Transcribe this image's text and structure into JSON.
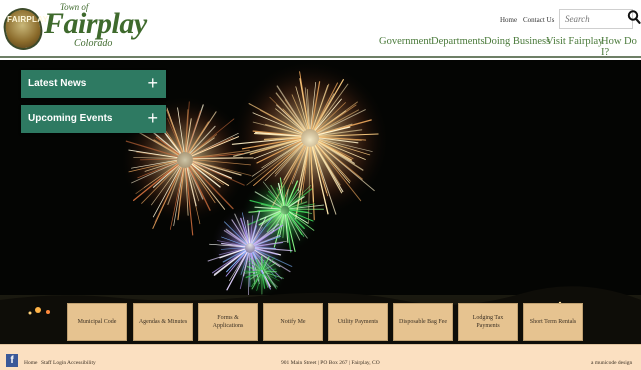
{
  "logo": {
    "town_of": "Town of",
    "name": "Fairplay",
    "state": "Colorado",
    "badge": "FAIRPLAY"
  },
  "utility_nav": {
    "home": "Home",
    "contact": "Contact Us"
  },
  "search": {
    "placeholder": "Search"
  },
  "main_nav": [
    "Government",
    "Departments",
    "Doing Business",
    "Visit Fairplay",
    "How Do I?"
  ],
  "accordion": [
    "Latest News",
    "Upcoming Events"
  ],
  "quick_links": [
    "Municipal Code",
    "Agendas & Minutes",
    "Forms & Applications",
    "Notify Me",
    "Utility Payments",
    "Disposable Bag Fee",
    "Lodging Tax Payments",
    "Short Term Rentals"
  ],
  "footer": {
    "links": [
      "Home",
      "Staff Login",
      "Accessibility"
    ],
    "address": "901 Main Street | PO Box 267 | Fairplay, CO",
    "credit": "a municode design"
  },
  "colors": {
    "brand_green": "#4a7a3a",
    "accordion_teal": "#2e7a62",
    "quick_link_tan": "#e6c390",
    "footer_bg": "#fbe0c1"
  },
  "icons": {
    "search": "search-icon",
    "facebook": "facebook-icon",
    "plus": "plus-icon"
  }
}
